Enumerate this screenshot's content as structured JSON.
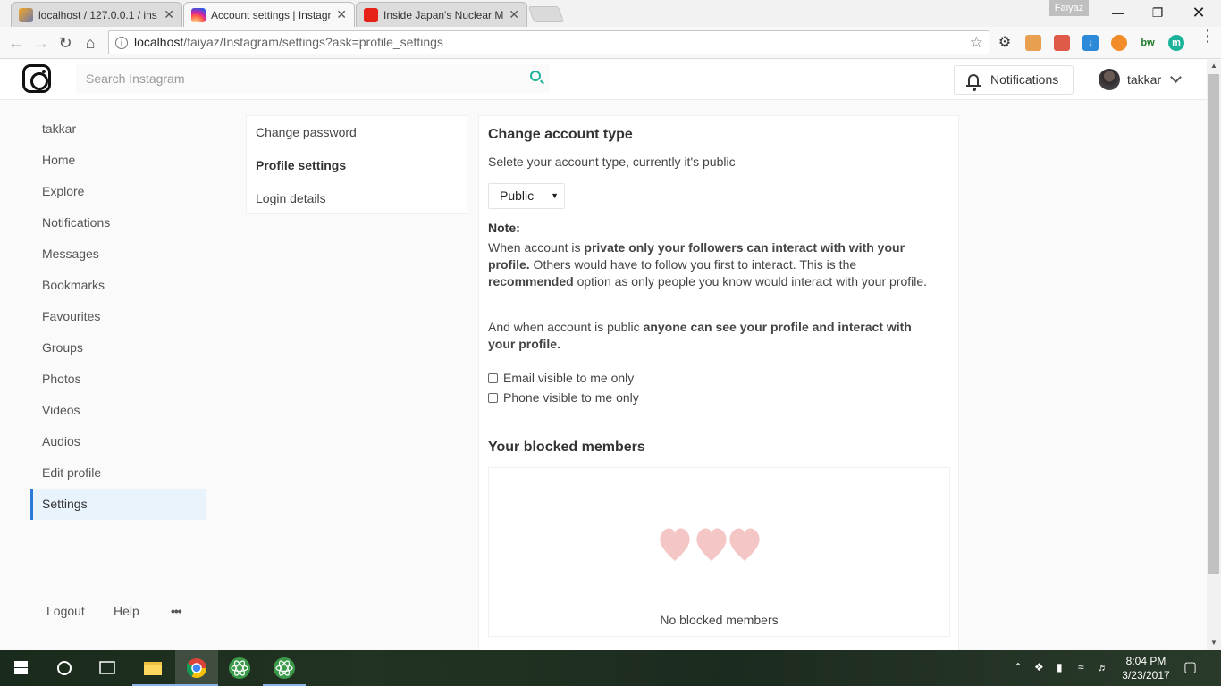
{
  "browser": {
    "tabs": [
      {
        "title": "localhost / 127.0.0.1 / ins",
        "favicon": "phpmyadmin-icon"
      },
      {
        "title": "Account settings | Instagr",
        "favicon": "instagram-icon"
      },
      {
        "title": "Inside Japan's Nuclear M",
        "favicon": "youtube-icon"
      }
    ],
    "profile_name": "Faiyaz",
    "url_host": "localhost",
    "url_path": "/faiyaz/Instagram/settings?ask=profile_settings"
  },
  "header": {
    "search_placeholder": "Search Instagram",
    "notifications_label": "Notifications",
    "username": "takkar"
  },
  "sidebar": {
    "items": [
      {
        "label": "takkar"
      },
      {
        "label": "Home"
      },
      {
        "label": "Explore"
      },
      {
        "label": "Notifications"
      },
      {
        "label": "Messages"
      },
      {
        "label": "Bookmarks"
      },
      {
        "label": "Favourites"
      },
      {
        "label": "Groups"
      },
      {
        "label": "Photos"
      },
      {
        "label": "Videos"
      },
      {
        "label": "Audios"
      },
      {
        "label": "Edit profile"
      },
      {
        "label": "Settings"
      }
    ],
    "footer": {
      "logout": "Logout",
      "help": "Help",
      "more": "•••"
    }
  },
  "settings_menu": {
    "items": [
      {
        "label": "Change password"
      },
      {
        "label": "Profile settings"
      },
      {
        "label": "Login details"
      }
    ]
  },
  "content": {
    "title": "Change account type",
    "subtitle": "Selete your account type, currently it's public",
    "account_type": "Public",
    "note_label": "Note:",
    "note1_a": "When account is ",
    "note1_b": "private only your followers can interact with with your profile.",
    "note1_c": " Others would have to follow you first to interact. This is the ",
    "note1_d": "recommended",
    "note1_e": " option as only people you know would interact with your profile.",
    "note2_a": "And when account is public ",
    "note2_b": "anyone can see your profile and interact with your profile.",
    "email_checkbox": "Email visible to me only",
    "phone_checkbox": "Phone visible to me only",
    "blocked_title": "Your blocked members",
    "no_blocked": "No blocked members"
  },
  "taskbar": {
    "time": "8:04 PM",
    "date": "3/23/2017"
  },
  "colors": {
    "accent": "#2b7bd6",
    "search_icon": "#1ab39a",
    "hearts": "#f4c6c6"
  }
}
